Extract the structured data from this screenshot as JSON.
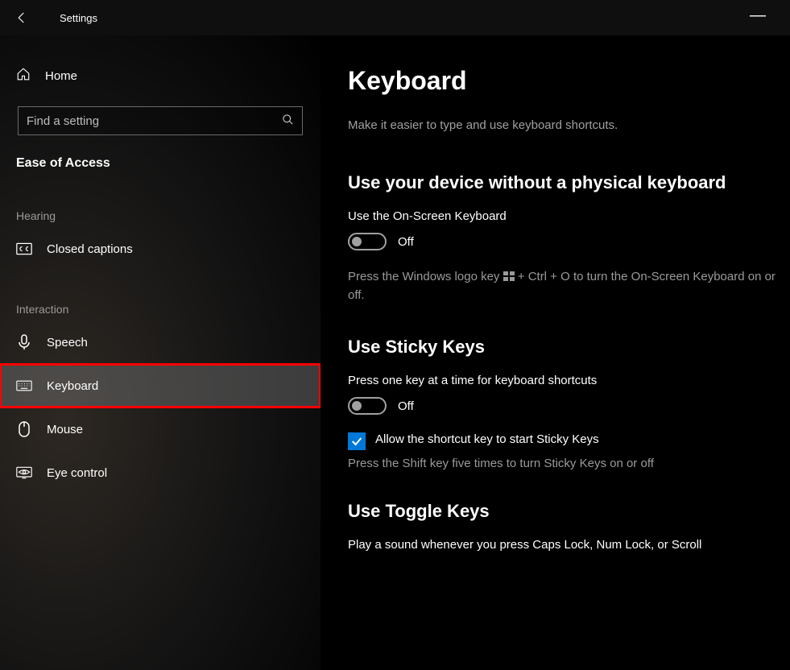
{
  "window": {
    "title": "Settings"
  },
  "sidebar": {
    "home": "Home",
    "search_placeholder": "Find a setting",
    "category": "Ease of Access",
    "group_hearing": "Hearing",
    "group_interaction": "Interaction",
    "items": {
      "closed_captions": "Closed captions",
      "speech": "Speech",
      "keyboard": "Keyboard",
      "mouse": "Mouse",
      "eye_control": "Eye control"
    }
  },
  "main": {
    "title": "Keyboard",
    "subtitle": "Make it easier to type and use keyboard shortcuts.",
    "section1": {
      "heading": "Use your device without a physical keyboard",
      "toggle_label": "Use the On-Screen Keyboard",
      "toggle_state": "Off",
      "hint_pre": "Press the Windows logo key ",
      "hint_post": " + Ctrl + O to turn the On-Screen Keyboard on or off."
    },
    "section2": {
      "heading": "Use Sticky Keys",
      "toggle_label": "Press one key at a time for keyboard shortcuts",
      "toggle_state": "Off",
      "checkbox_label": "Allow the shortcut key to start Sticky Keys",
      "hint": "Press the Shift key five times to turn Sticky Keys on or off"
    },
    "section3": {
      "heading": "Use Toggle Keys",
      "desc": "Play a sound whenever you press Caps Lock, Num Lock, or Scroll"
    }
  }
}
